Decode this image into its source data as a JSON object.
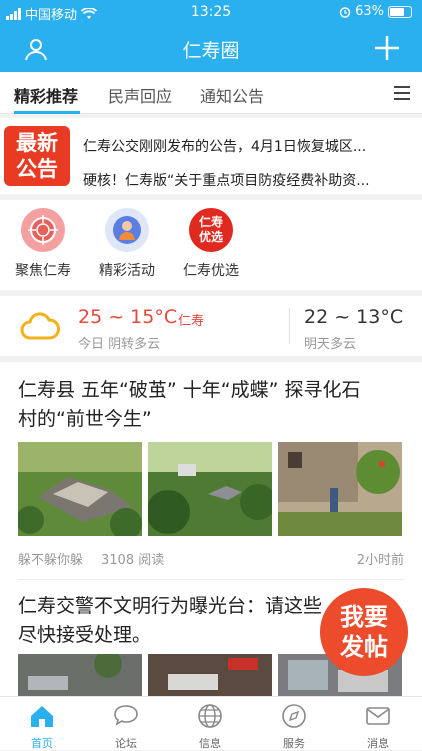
{
  "status": {
    "carrier": "中国移动",
    "time": "13:25",
    "battery": "63%",
    "battery_level": 0.63
  },
  "header": {
    "title": "仁寿圈"
  },
  "tabs": [
    {
      "label": "精彩推荐"
    },
    {
      "label": "民声回应"
    },
    {
      "label": "通知公告"
    }
  ],
  "notice": {
    "badge_line1": "最新",
    "badge_line2": "公告",
    "items": [
      "仁寿公交刚刚发布的公告，4月1日恢复城区...",
      "硬核！仁寿版“关于重点项目防疫经费补助资..."
    ]
  },
  "quick_links": [
    {
      "label": "聚焦仁寿",
      "icon": "target-icon"
    },
    {
      "label": "精彩活动",
      "icon": "person-icon"
    },
    {
      "label": "仁寿优选",
      "icon": "logo-badge",
      "badge_text1": "仁寿",
      "badge_text2": "优选"
    }
  ],
  "weather": {
    "today_temp": "25 ~ 15°C",
    "city": "仁寿",
    "today_desc": "今日 阴转多云",
    "tomorrow_temp": "22 ~ 13°C",
    "tomorrow_desc": "明天多云"
  },
  "feed": [
    {
      "title_line1": "仁寿县 五年“破茧” 十年“成蝶” 探寻化石",
      "title_line2": "村的“前世今生”",
      "source": "躲不躲你躲",
      "reads": "3108 阅读",
      "time": "2小时前"
    },
    {
      "title_line1": "仁寿交警不文明行为曝光台：请这些",
      "title_line2": "尽快接受处理。"
    }
  ],
  "fab": {
    "line1": "我要",
    "line2": "发帖"
  },
  "tabbar": [
    {
      "label": "首页"
    },
    {
      "label": "论坛"
    },
    {
      "label": "信息"
    },
    {
      "label": "服务"
    },
    {
      "label": "消息"
    }
  ],
  "colors": {
    "accent": "#2ab0ee",
    "badge_red": "#e93a24",
    "temp_red": "#e8483a"
  }
}
